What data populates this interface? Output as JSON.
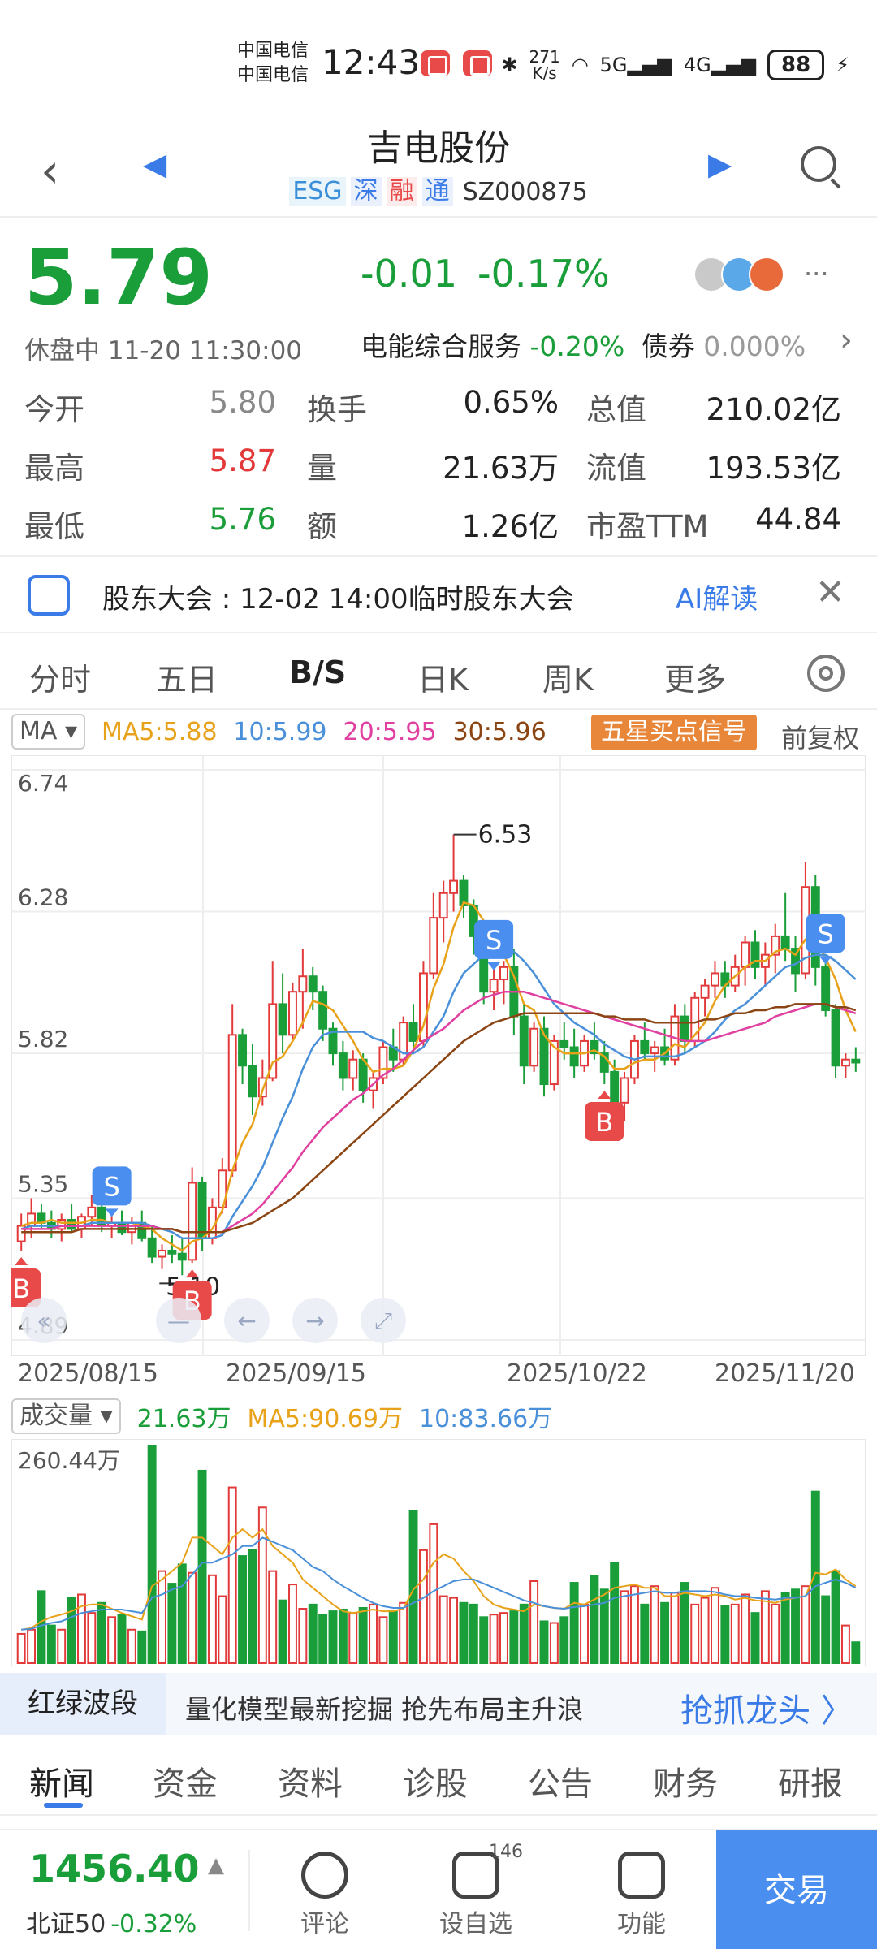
{
  "status_bar": {
    "carrier1": "中国电信",
    "carrier2": "中国电信",
    "time": "12:43",
    "speed_value": "271",
    "speed_unit": "K/s",
    "sig5g": "5G",
    "sig4g": "4G",
    "battery": "88"
  },
  "header": {
    "title": "吉电股份",
    "tag_esg": "ESG",
    "tag_shen": "深",
    "tag_rong": "融",
    "tag_tong": "通",
    "code": "SZ000875"
  },
  "quote": {
    "price": "5.79",
    "change": "-0.01",
    "change_pct": "-0.17%",
    "status": "休盘中 11-20 11:30:00",
    "sector_name": "电能综合服务",
    "sector_pct": "-0.20%",
    "bond_label": "债券",
    "bond_pct": "0.000%",
    "more": "···"
  },
  "stats": [
    {
      "label": "今开",
      "value": "5.80",
      "color": "gray"
    },
    {
      "label": "换手",
      "value": "0.65%",
      "color": "black"
    },
    {
      "label": "总值",
      "value": "210.02亿",
      "color": "black"
    },
    {
      "label": "最高",
      "value": "5.87",
      "color": "red"
    },
    {
      "label": "量",
      "value": "21.63万",
      "color": "black"
    },
    {
      "label": "流值",
      "value": "193.53亿",
      "color": "black"
    },
    {
      "label": "最低",
      "value": "5.76",
      "color": "green"
    },
    {
      "label": "额",
      "value": "1.26亿",
      "color": "black"
    },
    {
      "label": "市盈TTM",
      "value": "44.84",
      "color": "black"
    }
  ],
  "announcement": {
    "text": "股东大会 : 12-02 14:00临时股东大会",
    "ai": "AI解读"
  },
  "chart_tabs": [
    "分时",
    "五日",
    "B/S",
    "日K",
    "周K",
    "更多"
  ],
  "ma_bar": {
    "selector": "MA",
    "ma5": "MA5:5.88",
    "ma10": "10:5.99",
    "ma20": "20:5.95",
    "ma30": "30:5.96",
    "signal": "五星买点信号",
    "adjust": "前复权"
  },
  "chart_data": {
    "type": "candlestick",
    "y_ticks": [
      "6.74",
      "6.28",
      "5.82",
      "5.35",
      "4.89"
    ],
    "ylim": [
      4.89,
      6.74
    ],
    "x_labels": [
      "2025/08/15",
      "2025/09/15",
      "2025/10/22",
      "2025/11/20"
    ],
    "high_label": "6.53",
    "low_label": "5.10",
    "ohlc": [
      [
        5.21,
        5.3,
        5.18,
        5.26
      ],
      [
        5.26,
        5.35,
        5.22,
        5.3
      ],
      [
        5.3,
        5.33,
        5.25,
        5.27
      ],
      [
        5.27,
        5.31,
        5.22,
        5.25
      ],
      [
        5.25,
        5.3,
        5.21,
        5.28
      ],
      [
        5.28,
        5.33,
        5.24,
        5.25
      ],
      [
        5.25,
        5.3,
        5.22,
        5.29
      ],
      [
        5.29,
        5.36,
        5.26,
        5.32
      ],
      [
        5.32,
        5.35,
        5.24,
        5.26
      ],
      [
        5.26,
        5.3,
        5.22,
        5.27
      ],
      [
        5.27,
        5.31,
        5.23,
        5.24
      ],
      [
        5.24,
        5.29,
        5.2,
        5.27
      ],
      [
        5.27,
        5.31,
        5.21,
        5.22
      ],
      [
        5.22,
        5.26,
        5.14,
        5.16
      ],
      [
        5.16,
        5.2,
        5.12,
        5.18
      ],
      [
        5.18,
        5.23,
        5.14,
        5.17
      ],
      [
        5.17,
        5.22,
        5.1,
        5.15
      ],
      [
        5.15,
        5.45,
        5.14,
        5.4
      ],
      [
        5.4,
        5.42,
        5.18,
        5.22
      ],
      [
        5.22,
        5.35,
        5.2,
        5.32
      ],
      [
        5.32,
        5.48,
        5.3,
        5.44
      ],
      [
        5.44,
        5.98,
        5.42,
        5.88
      ],
      [
        5.88,
        5.9,
        5.72,
        5.78
      ],
      [
        5.78,
        5.85,
        5.62,
        5.68
      ],
      [
        5.68,
        5.8,
        5.65,
        5.74
      ],
      [
        5.74,
        6.12,
        5.73,
        5.98
      ],
      [
        5.98,
        6.08,
        5.82,
        5.88
      ],
      [
        5.88,
        6.05,
        5.86,
        6.02
      ],
      [
        6.02,
        6.16,
        5.9,
        6.07
      ],
      [
        6.07,
        6.1,
        5.96,
        6.02
      ],
      [
        6.02,
        6.04,
        5.86,
        5.9
      ],
      [
        5.9,
        5.92,
        5.78,
        5.82
      ],
      [
        5.82,
        5.86,
        5.7,
        5.74
      ],
      [
        5.74,
        5.83,
        5.7,
        5.8
      ],
      [
        5.8,
        5.82,
        5.66,
        5.7
      ],
      [
        5.7,
        5.76,
        5.64,
        5.74
      ],
      [
        5.74,
        5.86,
        5.72,
        5.84
      ],
      [
        5.84,
        5.9,
        5.76,
        5.8
      ],
      [
        5.8,
        5.94,
        5.78,
        5.92
      ],
      [
        5.92,
        5.98,
        5.82,
        5.86
      ],
      [
        5.86,
        6.12,
        5.84,
        6.08
      ],
      [
        6.08,
        6.34,
        6.06,
        6.26
      ],
      [
        6.26,
        6.38,
        6.18,
        6.34
      ],
      [
        6.34,
        6.53,
        6.28,
        6.38
      ],
      [
        6.38,
        6.4,
        6.26,
        6.3
      ],
      [
        6.3,
        6.32,
        6.14,
        6.2
      ],
      [
        6.2,
        6.22,
        5.98,
        6.02
      ],
      [
        6.02,
        6.1,
        5.96,
        6.06
      ],
      [
        6.06,
        6.12,
        5.98,
        6.1
      ],
      [
        6.1,
        6.16,
        5.88,
        5.94
      ],
      [
        5.94,
        5.98,
        5.72,
        5.78
      ],
      [
        5.78,
        5.92,
        5.76,
        5.9
      ],
      [
        5.9,
        5.94,
        5.68,
        5.72
      ],
      [
        5.72,
        5.88,
        5.7,
        5.86
      ],
      [
        5.86,
        5.92,
        5.8,
        5.84
      ],
      [
        5.84,
        5.9,
        5.74,
        5.78
      ],
      [
        5.78,
        5.88,
        5.76,
        5.86
      ],
      [
        5.86,
        5.92,
        5.8,
        5.82
      ],
      [
        5.82,
        5.86,
        5.72,
        5.76
      ],
      [
        5.76,
        5.8,
        5.62,
        5.66
      ],
      [
        5.66,
        5.76,
        5.6,
        5.74
      ],
      [
        5.74,
        5.88,
        5.72,
        5.86
      ],
      [
        5.86,
        5.92,
        5.8,
        5.82
      ],
      [
        5.82,
        5.86,
        5.76,
        5.84
      ],
      [
        5.84,
        5.9,
        5.78,
        5.8
      ],
      [
        5.8,
        5.98,
        5.78,
        5.94
      ],
      [
        5.94,
        5.98,
        5.82,
        5.86
      ],
      [
        5.86,
        6.02,
        5.84,
        6.0
      ],
      [
        6.0,
        6.06,
        5.94,
        6.04
      ],
      [
        6.04,
        6.12,
        6.0,
        6.08
      ],
      [
        6.08,
        6.12,
        6.0,
        6.04
      ],
      [
        6.04,
        6.14,
        6.02,
        6.1
      ],
      [
        6.1,
        6.2,
        6.04,
        6.18
      ],
      [
        6.18,
        6.22,
        6.06,
        6.1
      ],
      [
        6.1,
        6.18,
        6.04,
        6.14
      ],
      [
        6.14,
        6.24,
        6.08,
        6.2
      ],
      [
        6.2,
        6.34,
        6.12,
        6.16
      ],
      [
        6.16,
        6.2,
        6.02,
        6.08
      ],
      [
        6.08,
        6.44,
        6.06,
        6.36
      ],
      [
        6.36,
        6.4,
        6.04,
        6.1
      ],
      [
        6.1,
        6.12,
        5.94,
        5.96
      ],
      [
        5.96,
        5.98,
        5.74,
        5.78
      ],
      [
        5.78,
        5.82,
        5.74,
        5.8
      ],
      [
        5.8,
        5.84,
        5.76,
        5.79
      ]
    ],
    "ma5": [
      5.26,
      5.27,
      5.27,
      5.28,
      5.27,
      5.27,
      5.27,
      5.28,
      5.28,
      5.27,
      5.27,
      5.27,
      5.26,
      5.25,
      5.22,
      5.2,
      5.18,
      5.21,
      5.22,
      5.25,
      5.31,
      5.44,
      5.53,
      5.59,
      5.7,
      5.79,
      5.81,
      5.86,
      5.92,
      5.99,
      5.98,
      5.96,
      5.91,
      5.86,
      5.8,
      5.76,
      5.77,
      5.77,
      5.78,
      5.83,
      5.91,
      6.03,
      6.11,
      6.23,
      6.31,
      6.3,
      6.25,
      6.2,
      6.14,
      6.07,
      5.98,
      5.96,
      5.88,
      5.84,
      5.82,
      5.82,
      5.82,
      5.83,
      5.81,
      5.77,
      5.77,
      5.79,
      5.8,
      5.8,
      5.82,
      5.85,
      5.84,
      5.88,
      5.92,
      5.99,
      6.04,
      6.07,
      6.1,
      6.12,
      6.12,
      6.15,
      6.16,
      6.14,
      6.19,
      6.19,
      6.13,
      6.06,
      5.96,
      5.89
    ],
    "ma10": [
      5.25,
      5.26,
      5.26,
      5.26,
      5.26,
      5.26,
      5.26,
      5.27,
      5.27,
      5.27,
      5.27,
      5.27,
      5.27,
      5.26,
      5.25,
      5.24,
      5.22,
      5.22,
      5.22,
      5.22,
      5.23,
      5.29,
      5.34,
      5.39,
      5.45,
      5.53,
      5.61,
      5.68,
      5.77,
      5.84,
      5.88,
      5.89,
      5.89,
      5.89,
      5.89,
      5.87,
      5.86,
      5.84,
      5.82,
      5.82,
      5.84,
      5.89,
      5.94,
      6.02,
      6.08,
      6.11,
      6.14,
      6.15,
      6.17,
      6.15,
      6.12,
      6.08,
      6.03,
      5.98,
      5.95,
      5.92,
      5.9,
      5.88,
      5.85,
      5.83,
      5.81,
      5.8,
      5.81,
      5.81,
      5.81,
      5.81,
      5.82,
      5.84,
      5.86,
      5.89,
      5.93,
      5.96,
      5.98,
      6.01,
      6.04,
      6.07,
      6.1,
      6.11,
      6.13,
      6.14,
      6.14,
      6.12,
      6.09,
      6.06
    ],
    "ma20": [
      5.25,
      5.25,
      5.25,
      5.25,
      5.26,
      5.26,
      5.26,
      5.26,
      5.26,
      5.26,
      5.26,
      5.26,
      5.26,
      5.26,
      5.25,
      5.25,
      5.24,
      5.24,
      5.24,
      5.24,
      5.24,
      5.26,
      5.28,
      5.3,
      5.33,
      5.37,
      5.41,
      5.45,
      5.5,
      5.54,
      5.58,
      5.61,
      5.64,
      5.67,
      5.69,
      5.72,
      5.75,
      5.77,
      5.8,
      5.83,
      5.86,
      5.88,
      5.9,
      5.93,
      5.96,
      5.98,
      6.0,
      6.01,
      6.02,
      6.02,
      6.02,
      6.01,
      6.0,
      5.99,
      5.98,
      5.97,
      5.96,
      5.95,
      5.94,
      5.93,
      5.92,
      5.91,
      5.9,
      5.89,
      5.88,
      5.87,
      5.86,
      5.86,
      5.86,
      5.87,
      5.88,
      5.89,
      5.9,
      5.91,
      5.92,
      5.94,
      5.95,
      5.96,
      5.97,
      5.98,
      5.98,
      5.97,
      5.96,
      5.95
    ],
    "ma30": [
      5.24,
      5.24,
      5.24,
      5.24,
      5.24,
      5.24,
      5.25,
      5.25,
      5.25,
      5.25,
      5.25,
      5.25,
      5.25,
      5.25,
      5.25,
      5.25,
      5.24,
      5.24,
      5.24,
      5.24,
      5.24,
      5.25,
      5.26,
      5.27,
      5.29,
      5.31,
      5.33,
      5.35,
      5.38,
      5.41,
      5.44,
      5.47,
      5.5,
      5.53,
      5.56,
      5.59,
      5.62,
      5.65,
      5.68,
      5.71,
      5.74,
      5.77,
      5.8,
      5.83,
      5.86,
      5.88,
      5.9,
      5.92,
      5.93,
      5.94,
      5.95,
      5.95,
      5.95,
      5.95,
      5.95,
      5.95,
      5.95,
      5.95,
      5.94,
      5.94,
      5.93,
      5.93,
      5.93,
      5.92,
      5.92,
      5.92,
      5.92,
      5.92,
      5.93,
      5.93,
      5.94,
      5.95,
      5.95,
      5.96,
      5.96,
      5.97,
      5.97,
      5.98,
      5.98,
      5.98,
      5.98,
      5.97,
      5.97,
      5.96
    ],
    "signals": [
      {
        "type": "B",
        "index": 0
      },
      {
        "type": "S",
        "index": 9
      },
      {
        "type": "B",
        "index": 17
      },
      {
        "type": "S",
        "index": 47
      },
      {
        "type": "B",
        "index": 58
      },
      {
        "type": "S",
        "index": 80
      }
    ]
  },
  "volume_bar": {
    "selector": "成交量",
    "vol": "21.63万",
    "ma5": "MA5:90.69万",
    "ma10": "10:83.66万",
    "max_label": "260.44万"
  },
  "volume_data": {
    "values": [
      35,
      40,
      86,
      45,
      40,
      78,
      82,
      60,
      72,
      55,
      58,
      40,
      38,
      260,
      110,
      95,
      118,
      108,
      230,
      105,
      80,
      210,
      128,
      135,
      186,
      110,
      75,
      94,
      65,
      70,
      58,
      62,
      64,
      60,
      66,
      70,
      55,
      62,
      72,
      182,
      135,
      166,
      80,
      78,
      72,
      70,
      55,
      58,
      60,
      62,
      70,
      98,
      50,
      48,
      55,
      96,
      70,
      104,
      88,
      120,
      86,
      92,
      70,
      92,
      72,
      84,
      96,
      70,
      78,
      90,
      68,
      70,
      82,
      60,
      86,
      70,
      84,
      88,
      92,
      205,
      80,
      110,
      45,
      25
    ],
    "ma5": [
      40,
      42,
      50,
      55,
      58,
      62,
      68,
      70,
      70,
      65,
      60,
      56,
      52,
      92,
      100,
      110,
      120,
      150,
      150,
      140,
      130,
      150,
      160,
      150,
      160,
      140,
      130,
      120,
      100,
      90,
      80,
      70,
      62,
      60,
      62,
      64,
      62,
      62,
      65,
      88,
      100,
      120,
      130,
      125,
      110,
      98,
      80,
      70,
      66,
      64,
      62,
      70,
      68,
      66,
      65,
      72,
      70,
      76,
      82,
      90,
      92,
      94,
      90,
      90,
      80,
      80,
      84,
      82,
      80,
      82,
      80,
      76,
      78,
      75,
      74,
      72,
      76,
      78,
      80,
      108,
      106,
      112,
      100,
      92
    ],
    "ma10": [
      40,
      41,
      45,
      48,
      50,
      55,
      60,
      62,
      64,
      64,
      64,
      62,
      60,
      78,
      82,
      88,
      92,
      106,
      120,
      120,
      125,
      130,
      140,
      140,
      150,
      145,
      140,
      135,
      125,
      115,
      110,
      100,
      92,
      85,
      78,
      72,
      68,
      66,
      66,
      72,
      78,
      86,
      92,
      98,
      100,
      100,
      95,
      90,
      85,
      80,
      75,
      72,
      68,
      66,
      65,
      67,
      68,
      70,
      72,
      78,
      80,
      82,
      84,
      86,
      84,
      84,
      86,
      86,
      86,
      85,
      82,
      80,
      80,
      78,
      77,
      76,
      78,
      78,
      80,
      92,
      96,
      100,
      96,
      90
    ]
  },
  "banner": {
    "tag": "红绿波段",
    "text": "量化模型最新挖掘 抢先布局主升浪",
    "cta": "抢抓龙头 〉"
  },
  "news_tabs": [
    "新闻",
    "资金",
    "资料",
    "诊股",
    "公告",
    "财务",
    "研报"
  ],
  "bottom": {
    "index_value": "1456.40",
    "index_name": "北证50",
    "index_pct": "-0.32%",
    "comment": "评论",
    "watchlist": "设自选",
    "watch_count": "146",
    "function": "功能",
    "trade": "交易"
  },
  "colors": {
    "up": "#e23a3a",
    "down": "#1a9e3a",
    "accent": "#3a7be8",
    "ma5": "#e8a21a",
    "ma10": "#4a90d9",
    "ma20": "#e040a0",
    "ma30": "#8b4513"
  }
}
